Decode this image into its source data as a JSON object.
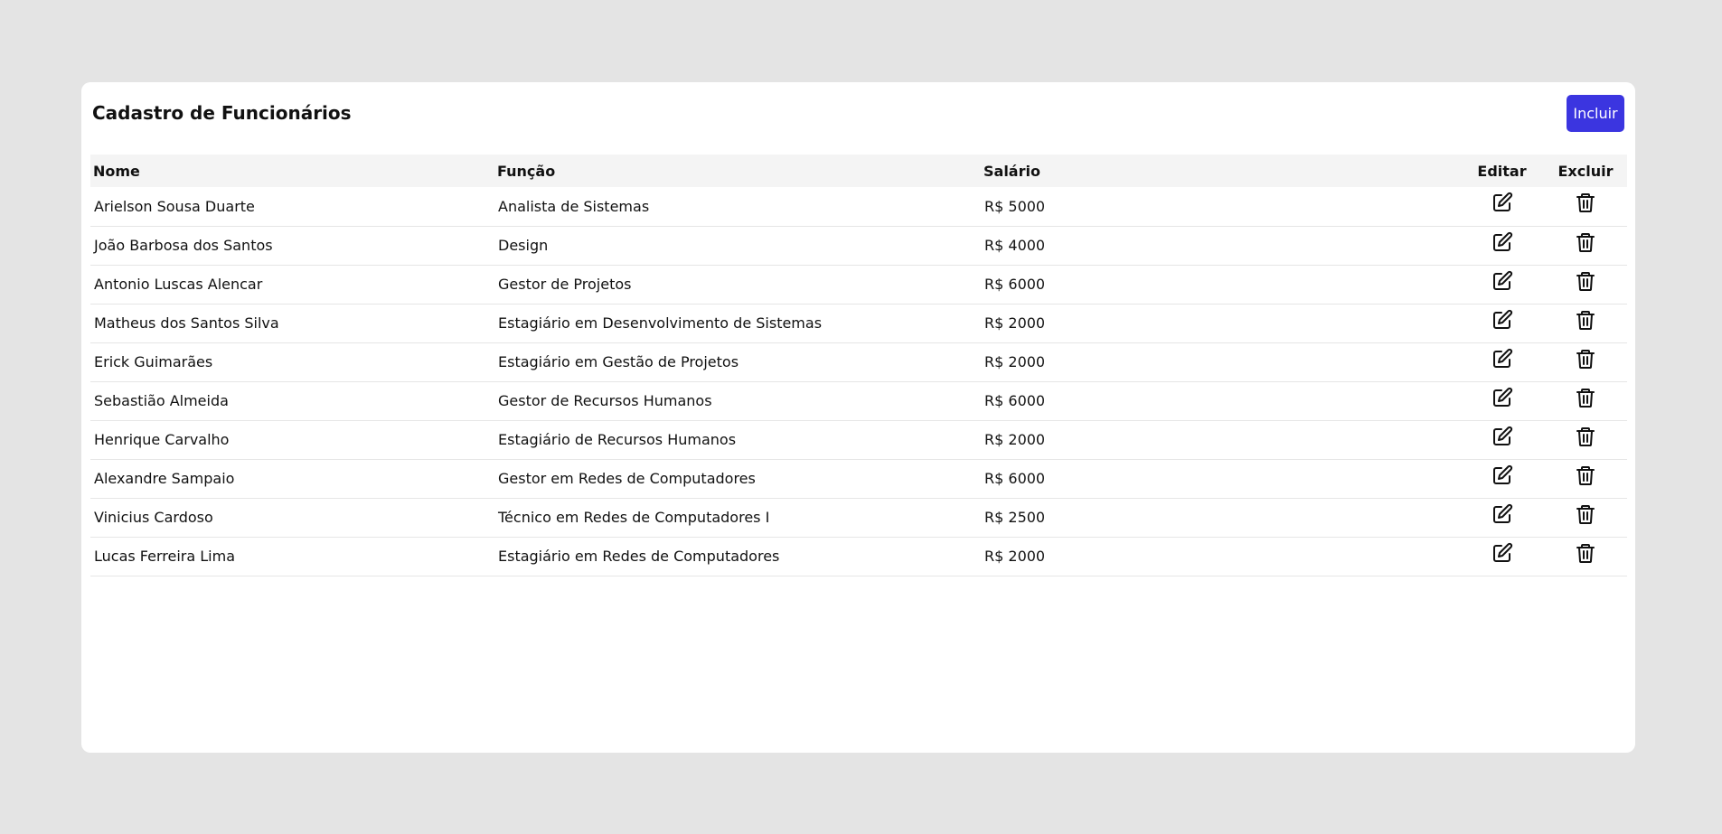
{
  "page": {
    "title": "Cadastro de Funcionários",
    "add_button_label": "Incluir"
  },
  "colors": {
    "background": "#e4e4e4",
    "card": "#ffffff",
    "accent": "#3b35e0",
    "header_row": "#f4f4f4"
  },
  "table": {
    "headers": {
      "name": "Nome",
      "role": "Função",
      "salary": "Salário",
      "edit": "Editar",
      "delete": "Excluir"
    },
    "edit_icon": "edit-icon",
    "delete_icon": "trash-icon",
    "rows": [
      {
        "name": "Arielson Sousa Duarte",
        "role": "Analista de Sistemas",
        "salary": "R$ 5000"
      },
      {
        "name": "João Barbosa dos Santos",
        "role": "Design",
        "salary": "R$ 4000"
      },
      {
        "name": "Antonio Luscas Alencar",
        "role": "Gestor de Projetos",
        "salary": "R$ 6000"
      },
      {
        "name": "Matheus dos Santos Silva",
        "role": "Estagiário em Desenvolvimento de Sistemas",
        "salary": "R$ 2000"
      },
      {
        "name": "Erick Guimarães",
        "role": "Estagiário em Gestão de Projetos",
        "salary": "R$ 2000"
      },
      {
        "name": "Sebastião Almeida",
        "role": "Gestor de Recursos Humanos",
        "salary": "R$ 6000"
      },
      {
        "name": "Henrique Carvalho",
        "role": "Estagiário de Recursos Humanos",
        "salary": "R$ 2000"
      },
      {
        "name": "Alexandre Sampaio",
        "role": "Gestor em Redes de Computadores",
        "salary": "R$ 6000"
      },
      {
        "name": "Vinicius Cardoso",
        "role": "Técnico em Redes de Computadores I",
        "salary": "R$ 2500"
      },
      {
        "name": "Lucas Ferreira Lima",
        "role": "Estagiário em Redes de Computadores",
        "salary": "R$ 2000"
      }
    ]
  }
}
